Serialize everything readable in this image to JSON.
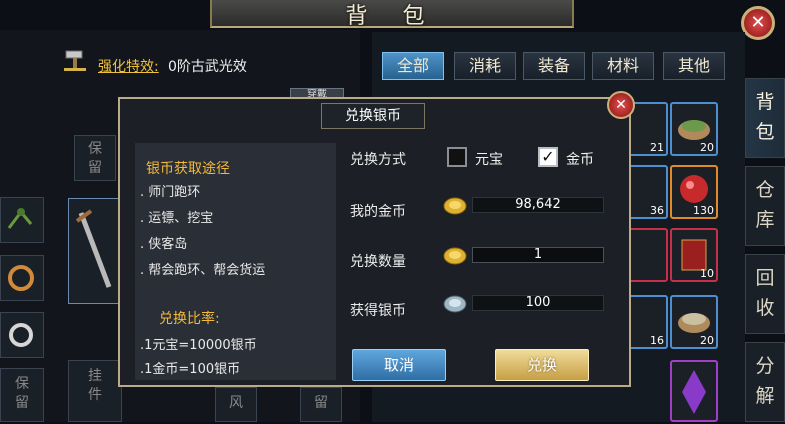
{
  "window": {
    "title": "背 包",
    "close_glyph": "✕"
  },
  "enhance": {
    "label": "强化特效:",
    "value": "0阶古武光效"
  },
  "left_slots": {
    "keep_top": "保留",
    "keep_bottom": "保留",
    "hang_bottom": "挂件",
    "partial_a": "风",
    "partial_b": "留",
    "partial_c": "穿戴"
  },
  "tabs": [
    {
      "label": "全部",
      "active": true
    },
    {
      "label": "消耗",
      "active": false
    },
    {
      "label": "装备",
      "active": false
    },
    {
      "label": "材料",
      "active": false
    },
    {
      "label": "其他",
      "active": false
    }
  ],
  "side_tabs": [
    {
      "label": "背包",
      "active": true
    },
    {
      "label": "仓库",
      "active": false
    },
    {
      "label": "回收",
      "active": false
    },
    {
      "label": "分解",
      "active": false
    }
  ],
  "grid_counts": {
    "r1c1": "21",
    "r1c2": "20",
    "r2c1": "36",
    "r2c2": "130",
    "r3c2": "10",
    "r4c1": "16",
    "r4c2": "20"
  },
  "dialog": {
    "title": "兑换银币",
    "close_glyph": "✕",
    "info_title": "银币获取途径",
    "info_lines": [
      ". 师门跑环",
      ". 运镖、挖宝",
      ". 侠客岛",
      ". 帮会跑环、帮会货运"
    ],
    "rate_title": "兑换比率:",
    "rate_lines": [
      ".1元宝=10000银币",
      ".1金币=100银币"
    ],
    "method_label": "兑换方式",
    "option_yuanbao": "元宝",
    "option_gold": "金币",
    "check_glyph": "✓",
    "my_gold_label": "我的金币",
    "my_gold_value": "98,642",
    "amount_label": "兑换数量",
    "amount_value": "1",
    "get_silver_label": "获得银币",
    "get_silver_value": "100",
    "cancel_label": "取消",
    "confirm_label": "兑换"
  },
  "colors": {
    "gold_accent": "#f2b93a",
    "tab_active": "#4f93c8",
    "frame": "#b9ac86"
  }
}
